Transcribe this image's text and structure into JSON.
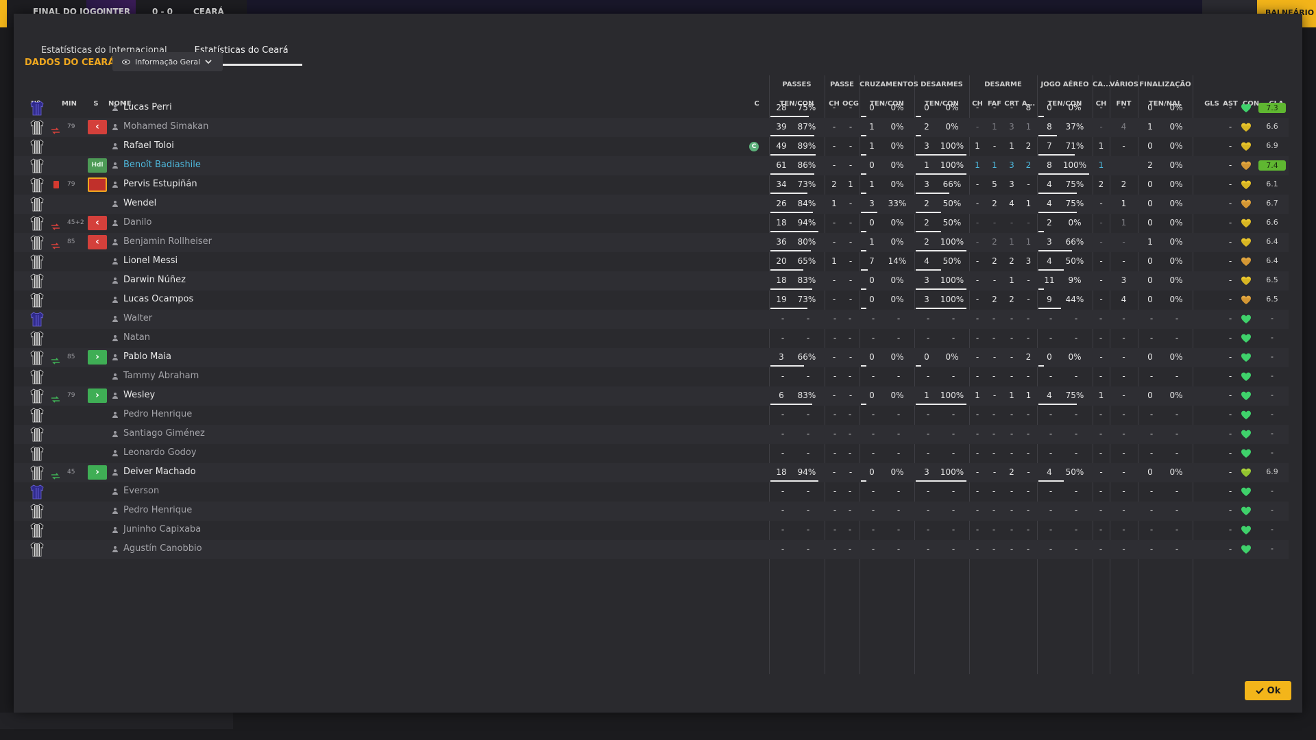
{
  "topbar": {
    "status": "FINAL DO JOGO",
    "home": "INTER",
    "score": "0 - 0",
    "away": "CEARÁ",
    "right_button": "BALNEÁRIO"
  },
  "tabs": [
    "Estatísticas do Internacional",
    "Estatísticas do Ceará"
  ],
  "section_title": "DADOS DO CEARÁ",
  "view_dropdown": "Informação Geral",
  "group_headers": [
    "PASSES",
    "PASSE",
    "CRUZAMENTOS",
    "DESARMES",
    "DESARME",
    "JOGO AÉREO",
    "CA...",
    "VÁRIOS",
    "FINALIZAÇÃO"
  ],
  "col_headers": {
    "num": "Nº",
    "min": "MIN",
    "s": "S",
    "name": "NOME",
    "c": "C",
    "passes": "TEN/CON",
    "passe_ch": "CH",
    "passe_ocg": "OCG",
    "cruz": "TEN/CON",
    "desarmes": "TEN/CON",
    "des_ch": "CH",
    "des_faf": "FAF",
    "des_crt": "CRT",
    "des_a": "A...",
    "aereo": "TEN/CON",
    "ca_ch": "CH",
    "varios_fnt": "FNT",
    "final": "TEN/NAL",
    "gls": "GLS",
    "ast": "AST",
    "con": "CON",
    "cla": "CLA"
  },
  "players": [
    {
      "name": "Lucas Perri",
      "kit": "gk",
      "min": "",
      "s": "",
      "dim": false,
      "hl": false,
      "cap": false,
      "pass": [
        "28",
        "75%",
        0.75
      ],
      "ch": "-",
      "ocg": "-",
      "cruz": [
        "0",
        "0%",
        0
      ],
      "des": [
        "0",
        "0%",
        0
      ],
      "dch": "-",
      "faf": "-",
      "crt": "-",
      "a": "8",
      "aer": [
        "0",
        "0%",
        0
      ],
      "cach": "-",
      "fnt": "-",
      "fin": [
        "0",
        "0%"
      ],
      "gls": "",
      "ast": "-",
      "con": "green",
      "cla": "7.3",
      "best": true
    },
    {
      "name": "Mohamed Simakan",
      "kit": "stripe",
      "min": "79",
      "s": "out",
      "dim": true,
      "hl": false,
      "cap": false,
      "pass": [
        "39",
        "87%",
        0.87
      ],
      "ch": "-",
      "ocg": "-",
      "cruz": [
        "1",
        "0%",
        0
      ],
      "des": [
        "2",
        "0%",
        0
      ],
      "dch": "-",
      "faf": "1",
      "crt": "3",
      "a": "1",
      "aer": [
        "8",
        "37%",
        0.37
      ],
      "cach": "-",
      "fnt": "4",
      "fin": [
        "1",
        "0%"
      ],
      "gls": "",
      "ast": "-",
      "con": "yellow",
      "cla": "6.6",
      "best": false
    },
    {
      "name": "Rafael Toloi",
      "kit": "stripe",
      "min": "",
      "s": "",
      "dim": false,
      "hl": false,
      "cap": true,
      "pass": [
        "49",
        "89%",
        0.89
      ],
      "ch": "-",
      "ocg": "-",
      "cruz": [
        "1",
        "0%",
        0
      ],
      "des": [
        "3",
        "100%",
        1
      ],
      "dch": "1",
      "faf": "-",
      "crt": "1",
      "a": "2",
      "aer": [
        "7",
        "71%",
        0.71
      ],
      "cach": "1",
      "fnt": "-",
      "fin": [
        "0",
        "0%"
      ],
      "gls": "",
      "ast": "-",
      "con": "yellow",
      "cla": "6.9",
      "best": false
    },
    {
      "name": "Benoît Badiashile",
      "kit": "stripe",
      "min": "",
      "s": "hd",
      "dim": false,
      "hl": true,
      "cap": false,
      "pass": [
        "61",
        "86%",
        0.86
      ],
      "ch": "-",
      "ocg": "-",
      "cruz": [
        "0",
        "0%",
        0
      ],
      "des": [
        "1",
        "100%",
        1
      ],
      "dch": "1",
      "faf": "1",
      "crt": "3",
      "a": "2",
      "aer": [
        "8",
        "100%",
        1
      ],
      "cach": "1",
      "fnt": "",
      "fin": [
        "2",
        "0%"
      ],
      "gls": "",
      "ast": "-",
      "con": "orange",
      "cla": "7.4",
      "best": true
    },
    {
      "name": "Pervis Estupiñán",
      "kit": "stripe",
      "min": "79",
      "s": "card",
      "dim": false,
      "hl": false,
      "cap": false,
      "pass": [
        "34",
        "73%",
        0.73
      ],
      "ch": "2",
      "ocg": "1",
      "cruz": [
        "1",
        "0%",
        0
      ],
      "des": [
        "3",
        "66%",
        0.66
      ],
      "dch": "-",
      "faf": "5",
      "crt": "3",
      "a": "-",
      "aer": [
        "4",
        "75%",
        0.75
      ],
      "cach": "2",
      "fnt": "2",
      "fin": [
        "0",
        "0%"
      ],
      "gls": "",
      "ast": "-",
      "con": "yellow",
      "cla": "6.1",
      "best": false
    },
    {
      "name": "Wendel",
      "kit": "stripe",
      "min": "",
      "s": "",
      "dim": false,
      "hl": false,
      "cap": false,
      "pass": [
        "26",
        "84%",
        0.84
      ],
      "ch": "1",
      "ocg": "-",
      "cruz": [
        "3",
        "33%",
        0.33
      ],
      "des": [
        "2",
        "50%",
        0.5
      ],
      "dch": "-",
      "faf": "2",
      "crt": "4",
      "a": "1",
      "aer": [
        "4",
        "75%",
        0.75
      ],
      "cach": "-",
      "fnt": "1",
      "fin": [
        "0",
        "0%"
      ],
      "gls": "",
      "ast": "-",
      "con": "orange",
      "cla": "6.7",
      "best": false
    },
    {
      "name": "Danilo",
      "kit": "stripe",
      "min": "45+2",
      "s": "out",
      "dim": true,
      "hl": false,
      "cap": false,
      "pass": [
        "18",
        "94%",
        0.94
      ],
      "ch": "-",
      "ocg": "-",
      "cruz": [
        "0",
        "0%",
        0
      ],
      "des": [
        "2",
        "50%",
        0.5
      ],
      "dch": "-",
      "faf": "-",
      "crt": "-",
      "a": "-",
      "aer": [
        "2",
        "0%",
        0
      ],
      "cach": "-",
      "fnt": "1",
      "fin": [
        "0",
        "0%"
      ],
      "gls": "",
      "ast": "-",
      "con": "yellow",
      "cla": "6.6",
      "best": false
    },
    {
      "name": "Benjamin Rollheiser",
      "kit": "stripe",
      "min": "85",
      "s": "out",
      "dim": true,
      "hl": false,
      "cap": false,
      "pass": [
        "36",
        "80%",
        0.8
      ],
      "ch": "-",
      "ocg": "-",
      "cruz": [
        "1",
        "0%",
        0
      ],
      "des": [
        "2",
        "100%",
        1
      ],
      "dch": "-",
      "faf": "2",
      "crt": "1",
      "a": "1",
      "aer": [
        "3",
        "66%",
        0.66
      ],
      "cach": "-",
      "fnt": "-",
      "fin": [
        "1",
        "0%"
      ],
      "gls": "",
      "ast": "-",
      "con": "yellow",
      "cla": "6.4",
      "best": false
    },
    {
      "name": "Lionel Messi",
      "kit": "stripe",
      "min": "",
      "s": "",
      "dim": false,
      "hl": false,
      "cap": false,
      "pass": [
        "20",
        "65%",
        0.65
      ],
      "ch": "1",
      "ocg": "-",
      "cruz": [
        "7",
        "14%",
        0.14
      ],
      "des": [
        "4",
        "50%",
        0.5
      ],
      "dch": "-",
      "faf": "2",
      "crt": "2",
      "a": "3",
      "aer": [
        "4",
        "50%",
        0.5
      ],
      "cach": "-",
      "fnt": "-",
      "fin": [
        "0",
        "0%"
      ],
      "gls": "",
      "ast": "-",
      "con": "orange",
      "cla": "6.4",
      "best": false
    },
    {
      "name": "Darwin Núñez",
      "kit": "stripe",
      "min": "",
      "s": "",
      "dim": false,
      "hl": false,
      "cap": false,
      "pass": [
        "18",
        "83%",
        0.83
      ],
      "ch": "-",
      "ocg": "-",
      "cruz": [
        "0",
        "0%",
        0
      ],
      "des": [
        "3",
        "100%",
        1
      ],
      "dch": "-",
      "faf": "-",
      "crt": "1",
      "a": "-",
      "aer": [
        "11",
        "9%",
        0.09
      ],
      "cach": "-",
      "fnt": "3",
      "fin": [
        "0",
        "0%"
      ],
      "gls": "",
      "ast": "-",
      "con": "yellow",
      "cla": "6.5",
      "best": false
    },
    {
      "name": "Lucas Ocampos",
      "kit": "stripe",
      "min": "",
      "s": "",
      "dim": false,
      "hl": false,
      "cap": false,
      "pass": [
        "19",
        "73%",
        0.73
      ],
      "ch": "-",
      "ocg": "-",
      "cruz": [
        "0",
        "0%",
        0
      ],
      "des": [
        "3",
        "100%",
        1
      ],
      "dch": "-",
      "faf": "2",
      "crt": "2",
      "a": "-",
      "aer": [
        "9",
        "44%",
        0.44
      ],
      "cach": "-",
      "fnt": "4",
      "fin": [
        "0",
        "0%"
      ],
      "gls": "",
      "ast": "-",
      "con": "orange",
      "cla": "6.5",
      "best": false
    },
    {
      "name": "Walter",
      "kit": "gk",
      "min": "",
      "s": "",
      "dim": true,
      "hl": false,
      "cap": false,
      "empty": true,
      "con": "green",
      "ast": "-",
      "cla": "-"
    },
    {
      "name": "Natan",
      "kit": "stripe",
      "min": "",
      "s": "",
      "dim": true,
      "hl": false,
      "cap": false,
      "empty": true,
      "con": "green",
      "ast": "-",
      "cla": "-"
    },
    {
      "name": "Pablo Maia",
      "kit": "stripe",
      "min": "85",
      "s": "in",
      "dim": false,
      "hl": false,
      "cap": false,
      "pass": [
        "3",
        "66%",
        0.66
      ],
      "ch": "-",
      "ocg": "-",
      "cruz": [
        "0",
        "0%",
        0
      ],
      "des": [
        "0",
        "0%",
        0
      ],
      "dch": "-",
      "faf": "-",
      "crt": "-",
      "a": "2",
      "aer": [
        "0",
        "0%",
        0
      ],
      "cach": "-",
      "fnt": "-",
      "fin": [
        "0",
        "0%"
      ],
      "gls": "",
      "ast": "-",
      "con": "green",
      "cla": "-",
      "best": false
    },
    {
      "name": "Tammy Abraham",
      "kit": "stripe",
      "min": "",
      "s": "",
      "dim": true,
      "hl": false,
      "cap": false,
      "empty": true,
      "con": "green",
      "ast": "-",
      "cla": "-"
    },
    {
      "name": "Wesley",
      "kit": "stripe",
      "min": "79",
      "s": "in",
      "dim": false,
      "hl": false,
      "cap": false,
      "pass": [
        "6",
        "83%",
        0.83
      ],
      "ch": "-",
      "ocg": "-",
      "cruz": [
        "0",
        "0%",
        0
      ],
      "des": [
        "1",
        "100%",
        1
      ],
      "dch": "1",
      "faf": "-",
      "crt": "1",
      "a": "1",
      "aer": [
        "4",
        "75%",
        0.75
      ],
      "cach": "1",
      "fnt": "-",
      "fin": [
        "0",
        "0%"
      ],
      "gls": "",
      "ast": "-",
      "con": "green",
      "cla": "-",
      "best": false
    },
    {
      "name": "Pedro Henrique",
      "kit": "stripe",
      "min": "",
      "s": "",
      "dim": true,
      "hl": false,
      "cap": false,
      "empty": true,
      "con": "green",
      "ast": "-",
      "cla": "-"
    },
    {
      "name": "Santiago Giménez",
      "kit": "stripe",
      "min": "",
      "s": "",
      "dim": true,
      "hl": false,
      "cap": false,
      "empty": true,
      "con": "green",
      "ast": "-",
      "cla": "-"
    },
    {
      "name": "Leonardo Godoy",
      "kit": "stripe",
      "min": "",
      "s": "",
      "dim": true,
      "hl": false,
      "cap": false,
      "empty": true,
      "con": "green",
      "ast": "-",
      "cla": "-"
    },
    {
      "name": "Deiver Machado",
      "kit": "stripe",
      "min": "45",
      "s": "in",
      "dim": false,
      "hl": false,
      "cap": false,
      "pass": [
        "18",
        "94%",
        0.94
      ],
      "ch": "-",
      "ocg": "-",
      "cruz": [
        "0",
        "0%",
        0
      ],
      "des": [
        "3",
        "100%",
        1
      ],
      "dch": "-",
      "faf": "-",
      "crt": "2",
      "a": "-",
      "aer": [
        "4",
        "50%",
        0.5
      ],
      "cach": "-",
      "fnt": "-",
      "fin": [
        "0",
        "0%"
      ],
      "gls": "",
      "ast": "-",
      "con": "yellowgreen",
      "cla": "6.9",
      "best": false
    },
    {
      "name": "Everson",
      "kit": "gk",
      "min": "",
      "s": "",
      "dim": true,
      "hl": false,
      "cap": false,
      "empty": true,
      "con": "green",
      "ast": "-",
      "cla": "-"
    },
    {
      "name": "Pedro Henrique",
      "kit": "stripe",
      "min": "",
      "s": "",
      "dim": true,
      "hl": false,
      "cap": false,
      "empty": true,
      "con": "green",
      "ast": "-",
      "cla": "-"
    },
    {
      "name": "Juninho Capixaba",
      "kit": "stripe",
      "min": "",
      "s": "",
      "dim": true,
      "hl": false,
      "cap": false,
      "empty": true,
      "con": "green",
      "ast": "-",
      "cla": "-"
    },
    {
      "name": "Agustín Canobbio",
      "kit": "stripe",
      "min": "",
      "s": "",
      "dim": true,
      "hl": false,
      "cap": false,
      "empty": true,
      "con": "green",
      "ast": "-",
      "cla": "-"
    }
  ],
  "ok_label": "Ok",
  "colors": {
    "accent": "#f3b51a",
    "title": "#f0a81f",
    "best_rating": "#5fb731",
    "sub_out": "#d4403b",
    "sub_in": "#3fae55",
    "heart_green": "#3fd16b",
    "heart_yellow": "#e9c52c",
    "heart_orange": "#e0a540"
  }
}
